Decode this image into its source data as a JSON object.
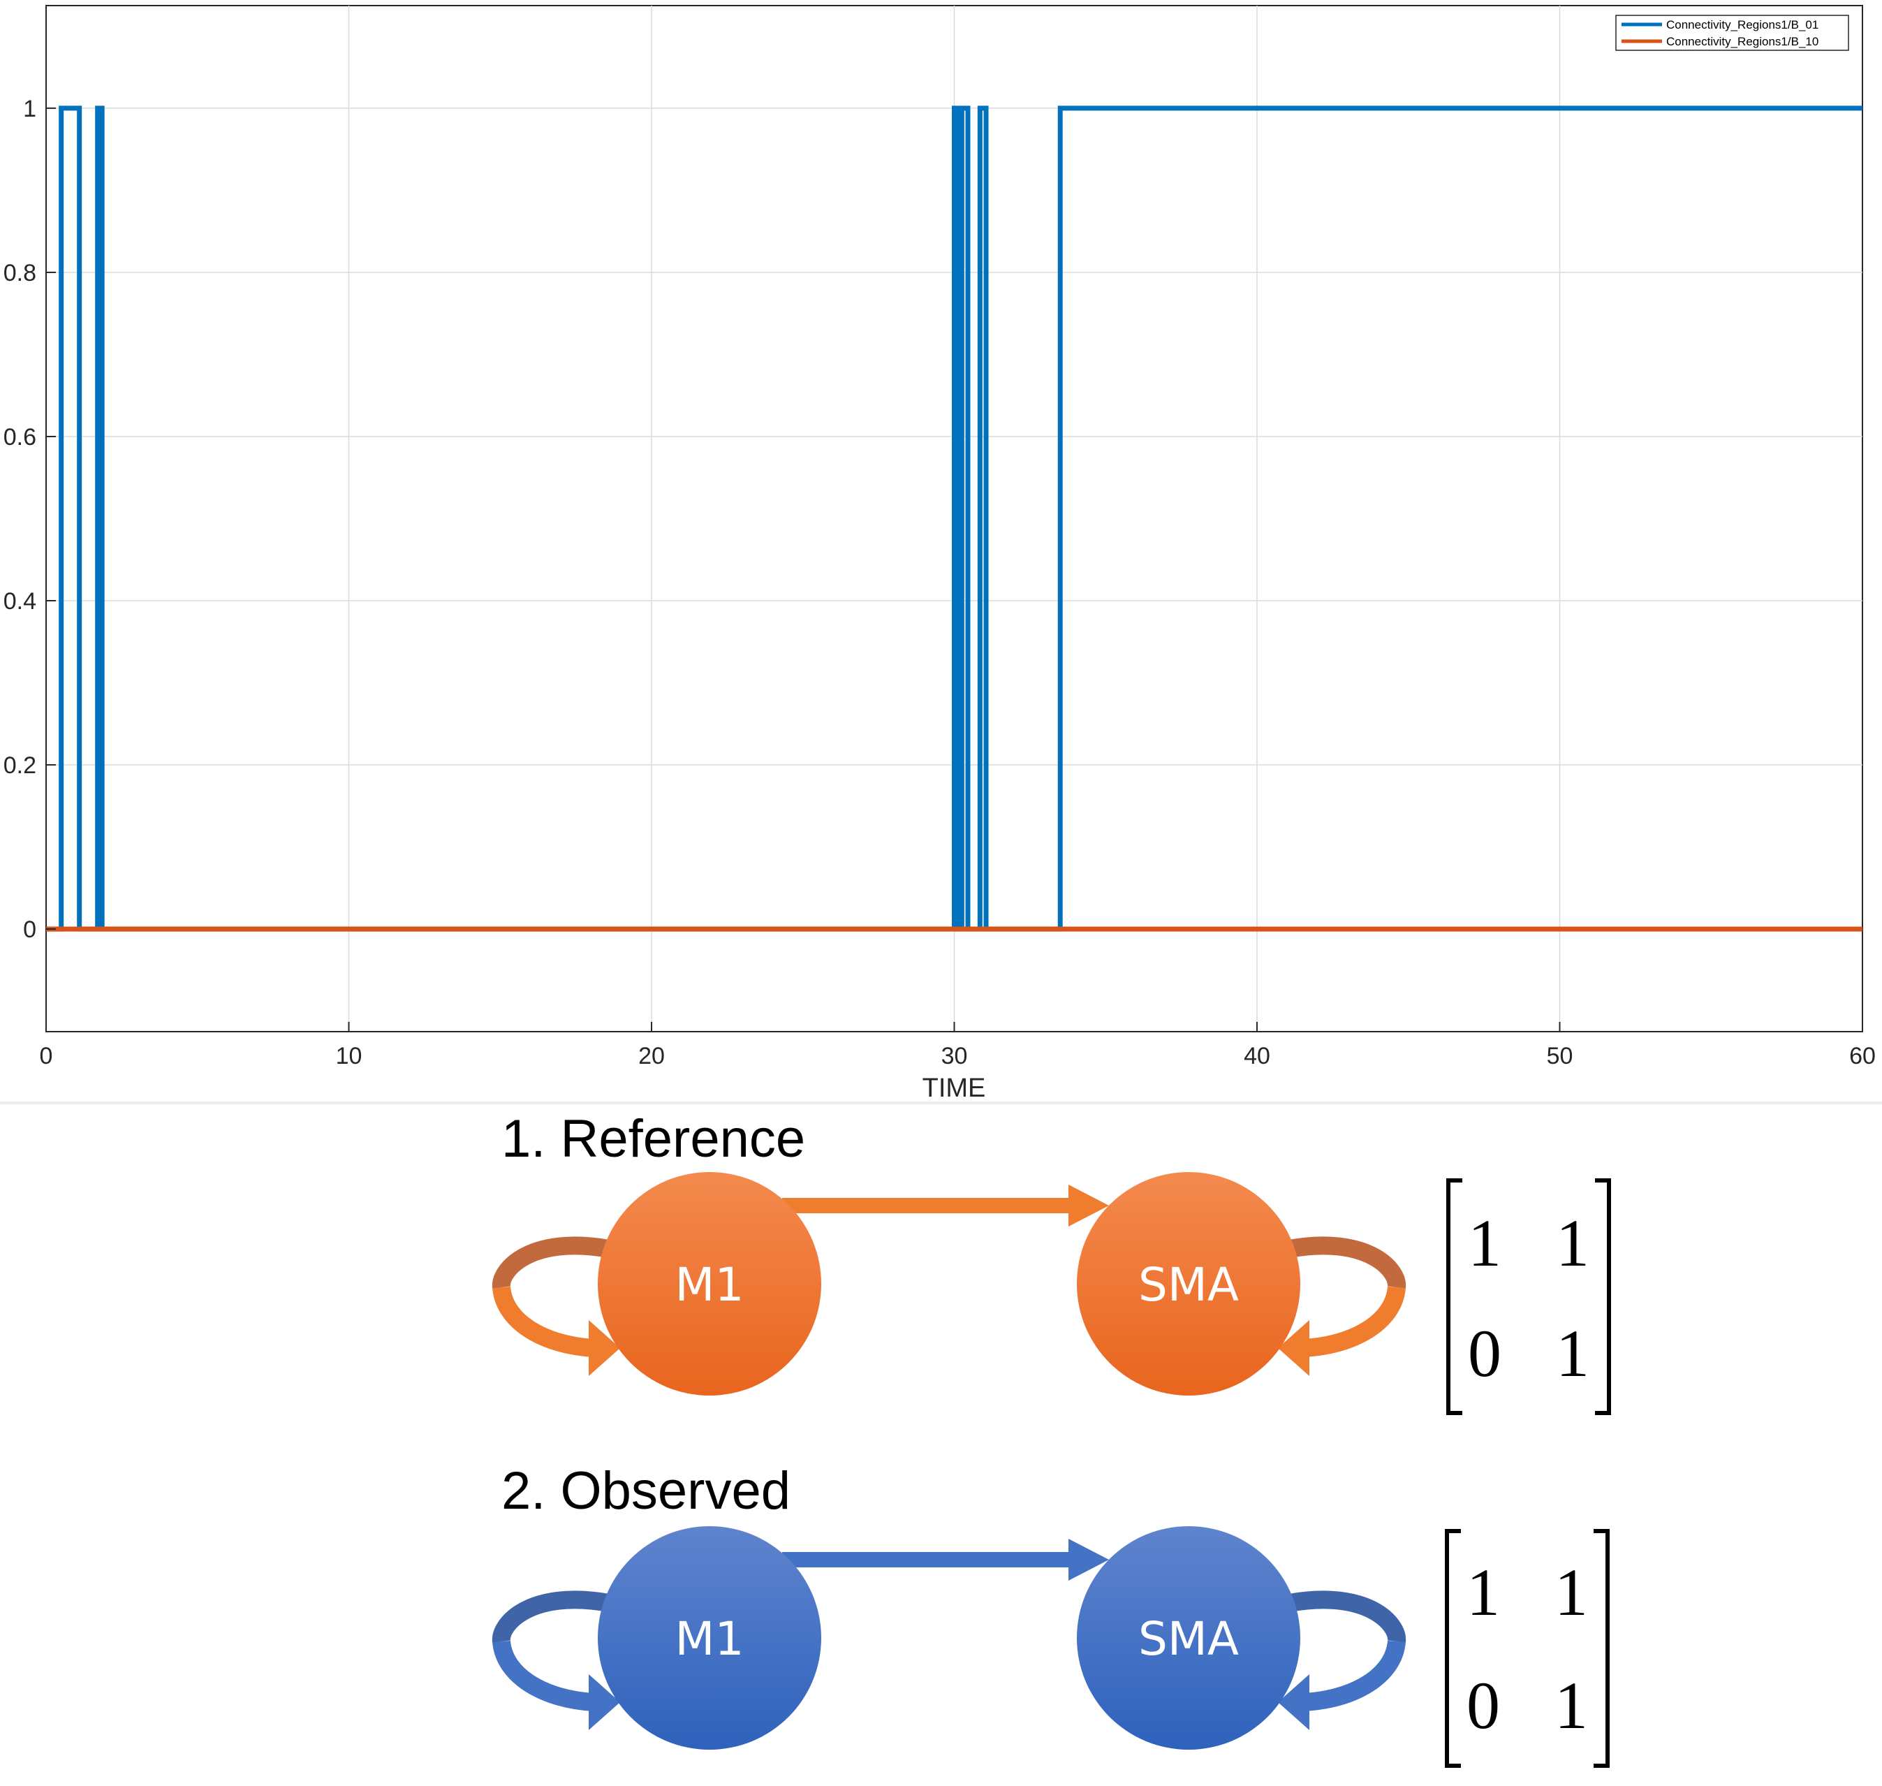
{
  "chart_data": {
    "type": "line",
    "title": "",
    "xlabel": "TIME",
    "ylabel": "",
    "xlim": [
      0,
      60
    ],
    "ylim": [
      -0.125,
      1.125
    ],
    "xticks": [
      0,
      10,
      20,
      30,
      40,
      50,
      60
    ],
    "yticks": [
      0,
      0.2,
      0.4,
      0.6,
      0.8,
      1
    ],
    "ytick_labels": [
      "0",
      "0.2",
      "0.4",
      "0.6",
      "0.8",
      "1"
    ],
    "grid": true,
    "legend_position": "top-right",
    "step": true,
    "series": [
      {
        "name": "Connectivity_Regions1/B_01",
        "color": "#0072BD",
        "x": [
          0,
          0.5,
          1.1,
          1.7,
          1.85,
          30.0,
          30.15,
          30.25,
          30.45,
          30.85,
          31.05,
          33.5,
          60
        ],
        "y": [
          0,
          1,
          0,
          1,
          0,
          1,
          0,
          1,
          0,
          1,
          0,
          1,
          1
        ]
      },
      {
        "name": "Connectivity_Regions1/B_10",
        "color": "#D95319",
        "x": [
          0,
          60
        ],
        "y": [
          0,
          0
        ]
      }
    ]
  },
  "diagrams": [
    {
      "title": "1. Reference",
      "color_top": "#F48A4E",
      "color_bottom": "#E8651E",
      "color_arrow_dark": "#C26A3E",
      "color_arrow_light": "#F07C2E",
      "node_left": "M1",
      "node_right": "SMA",
      "matrix": [
        "1",
        "1",
        "0",
        "1"
      ]
    },
    {
      "title": "2. Observed",
      "color_top": "#5F84CE",
      "color_bottom": "#2E62BC",
      "color_arrow_dark": "#3F64A8",
      "color_arrow_light": "#4472C4",
      "node_left": "M1",
      "node_right": "SMA",
      "matrix": [
        "1",
        "1",
        "0",
        "1"
      ]
    }
  ]
}
